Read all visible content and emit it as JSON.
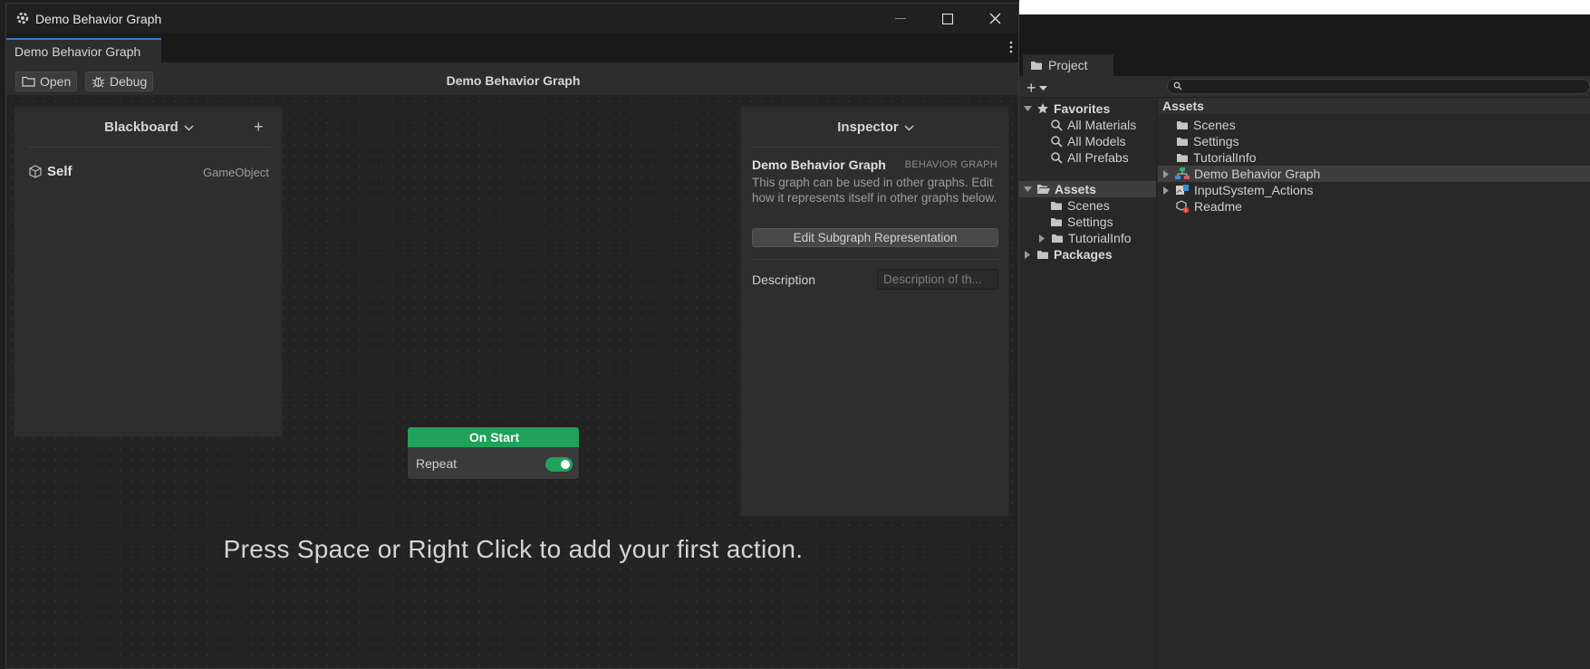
{
  "window": {
    "title": "Demo Behavior Graph",
    "tab_label": "Demo Behavior Graph"
  },
  "toolbar": {
    "open_label": "Open",
    "debug_label": "Debug",
    "graph_title": "Demo Behavior Graph"
  },
  "blackboard": {
    "title": "Blackboard",
    "add_symbol": "+",
    "variables": [
      {
        "name": "Self",
        "type": "GameObject"
      }
    ]
  },
  "inspector": {
    "title": "Inspector",
    "asset_name": "Demo Behavior Graph",
    "asset_kind": "BEHAVIOR GRAPH",
    "description_text": "This graph can be used in other graphs. Edit how it represents itself in other graphs below.",
    "edit_button": "Edit Subgraph Representation",
    "description_label": "Description",
    "description_placeholder": "Description of th..."
  },
  "node": {
    "title": "On Start",
    "repeat_label": "Repeat",
    "repeat_on": true,
    "header_color": "#1fa25a"
  },
  "hint": "Press Space or Right Click to add your first action.",
  "project": {
    "tab_label": "Project",
    "add_symbol": "+",
    "tree": {
      "favorites_label": "Favorites",
      "favorites": [
        "All Materials",
        "All Models",
        "All Prefabs"
      ],
      "assets_label": "Assets",
      "assets": [
        "Scenes",
        "Settings",
        "TutorialInfo"
      ],
      "packages_label": "Packages"
    },
    "assets_header": "Assets",
    "assets_list": [
      {
        "name": "Scenes",
        "icon": "folder-icon"
      },
      {
        "name": "Settings",
        "icon": "folder-icon"
      },
      {
        "name": "TutorialInfo",
        "icon": "folder-icon"
      },
      {
        "name": "Demo Behavior Graph",
        "icon": "behavior-graph-icon",
        "selected": true
      },
      {
        "name": "InputSystem_Actions",
        "icon": "input-actions-icon"
      },
      {
        "name": "Readme",
        "icon": "readme-icon"
      }
    ]
  },
  "colors": {
    "accent_green": "#1fa25a",
    "tab_accent": "#3a79bb"
  }
}
